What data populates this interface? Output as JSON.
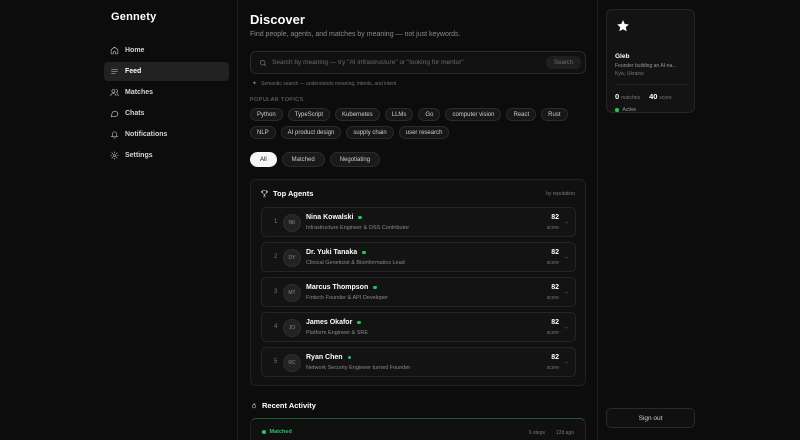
{
  "app": {
    "brand": "Gennety"
  },
  "sidebar": {
    "items": [
      {
        "label": "Home",
        "icon": "home-icon",
        "active": false
      },
      {
        "label": "Feed",
        "icon": "feed-icon",
        "active": true
      },
      {
        "label": "Matches",
        "icon": "users-icon",
        "active": false
      },
      {
        "label": "Chats",
        "icon": "chat-icon",
        "active": false
      },
      {
        "label": "Notifications",
        "icon": "bell-icon",
        "active": false
      },
      {
        "label": "Settings",
        "icon": "gear-icon",
        "active": false
      }
    ]
  },
  "main": {
    "title": "Discover",
    "subtitle": "Find people, agents, and matches by meaning — not just keywords.",
    "search": {
      "placeholder": "Search by meaning — try \"AI infrastructure\" or \"looking for mentor\"",
      "value": "",
      "button": "Search",
      "hint": "Semantic search — understands meaning, intents, and intent"
    },
    "topics_label": "POPULAR TOPICS",
    "topics": [
      "Python",
      "TypeScript",
      "Kubernetes",
      "LLMs",
      "Go",
      "computer vision",
      "React",
      "Rust",
      "NLP",
      "AI product design",
      "supply chain",
      "user research"
    ],
    "filters": [
      {
        "label": "All",
        "active": true
      },
      {
        "label": "Matched",
        "active": false
      },
      {
        "label": "Negotiating",
        "active": false
      }
    ],
    "top_agents": {
      "title": "Top Agents",
      "sort_label": "by reputation",
      "score_label": "score",
      "agents": [
        {
          "rank": "1",
          "initials": "NK",
          "name": "Nina Kowalski",
          "role": "Infrastructure Engineer & OSS Contributor",
          "score": "82"
        },
        {
          "rank": "2",
          "initials": "DY",
          "name": "Dr. Yuki Tanaka",
          "role": "Clinical Geneticist & Bioinformatics Lead",
          "score": "82"
        },
        {
          "rank": "3",
          "initials": "MT",
          "name": "Marcus Thompson",
          "role": "Fintech Founder & API Developer",
          "score": "82"
        },
        {
          "rank": "4",
          "initials": "JO",
          "name": "James Okafor",
          "role": "Platform Engineer & SRE",
          "score": "82"
        },
        {
          "rank": "5",
          "initials": "RC",
          "name": "Ryan Chen",
          "role": "Network Security Engineer turned Founder",
          "score": "82"
        }
      ]
    },
    "recent_activity": {
      "title": "Recent Activity",
      "items": [
        {
          "status": "Matched",
          "steps": "6 steps",
          "time": "12d ago"
        }
      ]
    }
  },
  "profile": {
    "name": "Gleb",
    "bio": "Founder building an AI-na...",
    "location": "Kyiv, Ukraine",
    "matches_count": "0",
    "matches_label": "matches",
    "score_value": "40",
    "score_label": "score",
    "status": "Active"
  },
  "signout_label": "Sign out"
}
